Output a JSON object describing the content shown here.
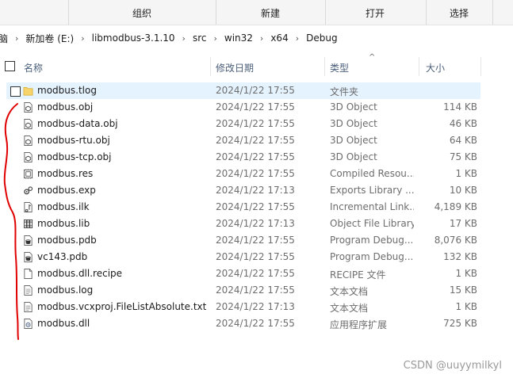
{
  "ribbon": {
    "groups": [
      "组织",
      "新建",
      "打开",
      "选择"
    ]
  },
  "address": {
    "segments": [
      "脑",
      "新加卷 (E:)",
      "libmodbus-3.1.10",
      "src",
      "win32",
      "x64",
      "Debug"
    ]
  },
  "columns": {
    "name": "名称",
    "date": "修改日期",
    "type": "类型",
    "size": "大小"
  },
  "files": [
    {
      "name": "modbus.tlog",
      "date": "2024/1/22 17:55",
      "type": "文件夹",
      "size": "",
      "icon": "folder-icon"
    },
    {
      "name": "modbus.obj",
      "date": "2024/1/22 17:55",
      "type": "3D Object",
      "size": "114 KB",
      "icon": "object-file-icon"
    },
    {
      "name": "modbus-data.obj",
      "date": "2024/1/22 17:55",
      "type": "3D Object",
      "size": "46 KB",
      "icon": "object-file-icon"
    },
    {
      "name": "modbus-rtu.obj",
      "date": "2024/1/22 17:55",
      "type": "3D Object",
      "size": "64 KB",
      "icon": "object-file-icon"
    },
    {
      "name": "modbus-tcp.obj",
      "date": "2024/1/22 17:55",
      "type": "3D Object",
      "size": "75 KB",
      "icon": "object-file-icon"
    },
    {
      "name": "modbus.res",
      "date": "2024/1/22 17:55",
      "type": "Compiled Resou...",
      "size": "1 KB",
      "icon": "resource-file-icon"
    },
    {
      "name": "modbus.exp",
      "date": "2024/1/22 17:13",
      "type": "Exports Library ...",
      "size": "10 KB",
      "icon": "exports-file-icon"
    },
    {
      "name": "modbus.ilk",
      "date": "2024/1/22 17:55",
      "type": "Incremental Link...",
      "size": "4,189 KB",
      "icon": "ilk-file-icon"
    },
    {
      "name": "modbus.lib",
      "date": "2024/1/22 17:13",
      "type": "Object File Library",
      "size": "17 KB",
      "icon": "library-file-icon"
    },
    {
      "name": "modbus.pdb",
      "date": "2024/1/22 17:55",
      "type": "Program Debug...",
      "size": "8,076 KB",
      "icon": "pdb-file-icon"
    },
    {
      "name": "vc143.pdb",
      "date": "2024/1/22 17:55",
      "type": "Program Debug...",
      "size": "132 KB",
      "icon": "pdb-file-icon"
    },
    {
      "name": "modbus.dll.recipe",
      "date": "2024/1/22 17:55",
      "type": "RECIPE 文件",
      "size": "1 KB",
      "icon": "generic-file-icon"
    },
    {
      "name": "modbus.log",
      "date": "2024/1/22 17:55",
      "type": "文本文档",
      "size": "15 KB",
      "icon": "text-file-icon"
    },
    {
      "name": "modbus.vcxproj.FileListAbsolute.txt",
      "date": "2024/1/22 17:13",
      "type": "文本文档",
      "size": "1 KB",
      "icon": "text-file-icon"
    },
    {
      "name": "modbus.dll",
      "date": "2024/1/22 17:55",
      "type": "应用程序扩展",
      "size": "725 KB",
      "icon": "dll-file-icon"
    }
  ],
  "watermark": "CSDN @uuyymilkyl",
  "colors": {
    "selection": "#e5f3ff",
    "header_text": "#4c607a",
    "annotation": "#e00000"
  }
}
